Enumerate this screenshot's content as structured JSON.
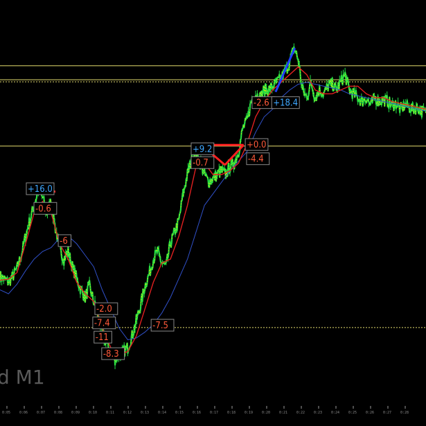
{
  "watermark": "d M1",
  "colors": {
    "background": "#000000",
    "price_green": "#22dd44",
    "price_yellow": "#f2e800",
    "ma_fast": "#e02020",
    "ma_slow": "#3050c8",
    "level_line": "#e8e070",
    "tag_blue": "#3fa8ff",
    "tag_red": "#ff5a3a",
    "tag_box": "#8a8a8a",
    "trade_line_red": "#ff2020",
    "trade_line_blue": "#2040ff"
  },
  "chart_data": {
    "type": "line",
    "title": "",
    "xlabel": "",
    "ylabel": "",
    "grid": false,
    "x_tick_labels": [
      "0:05",
      "0:06",
      "0:07",
      "0:08",
      "0:09",
      "0:10",
      "0:11",
      "0:12",
      "0:13",
      "0:14",
      "0:15",
      "0:16",
      "0:17",
      "0:18",
      "0:19",
      "0:20",
      "0:21",
      "0:22",
      "0:23",
      "0:24",
      "0:25",
      "0:26",
      "0:27",
      "0:28"
    ],
    "ylim": [
      0,
      100
    ],
    "xlim": [
      0,
      100
    ],
    "horizontal_levels": [
      {
        "value": 88.3,
        "style": "solid"
      },
      {
        "value": 84.4,
        "style": "double"
      },
      {
        "value": 67.4,
        "style": "solid"
      },
      {
        "value": 20.2,
        "style": "dotted"
      }
    ],
    "series": [
      {
        "role": "price",
        "x": [
          0,
          1,
          2,
          3,
          4,
          5,
          6,
          7,
          8,
          9,
          10,
          11,
          12,
          13,
          14,
          15,
          16,
          17,
          18,
          19,
          20,
          21,
          22,
          23,
          24,
          25,
          26,
          27,
          28,
          29,
          30,
          31,
          32,
          33,
          34,
          35,
          36,
          37,
          38,
          39,
          40,
          41,
          42,
          43,
          44,
          45,
          46,
          47,
          48,
          49,
          50,
          51,
          52,
          53,
          54,
          55,
          56,
          57,
          58,
          59,
          60,
          61,
          62,
          63,
          64,
          65,
          66,
          67,
          68,
          69,
          70,
          71,
          72,
          73,
          74,
          75,
          76,
          77,
          78,
          79,
          80,
          81,
          82,
          83,
          84,
          85,
          86,
          87,
          88,
          89,
          90,
          91,
          92,
          93,
          94,
          95,
          96,
          97,
          98,
          99,
          100
        ],
        "values": [
          33.5,
          32.8,
          32,
          33.5,
          35.5,
          39,
          44,
          48,
          52,
          56,
          54,
          50,
          53,
          46,
          41,
          38,
          40,
          36,
          33,
          30,
          28,
          31,
          27,
          23,
          19,
          16,
          14,
          12,
          13,
          14,
          15,
          18,
          22,
          26,
          31,
          34,
          38,
          40,
          37,
          36,
          42,
          45,
          48,
          55,
          60,
          64,
          66,
          63,
          60,
          58,
          59,
          60,
          61,
          60,
          62,
          63,
          66,
          72,
          74,
          79,
          81,
          80,
          82,
          82,
          83,
          84,
          85,
          87,
          89,
          93,
          90,
          82,
          80,
          84,
          80,
          82,
          81,
          83,
          83.5,
          82,
          84,
          86,
          82,
          81,
          80,
          79,
          80,
          78,
          80,
          79,
          79.5,
          79,
          78,
          78.5,
          77,
          78,
          77.5,
          77,
          77.5,
          76.5,
          76
        ]
      },
      {
        "role": "moving-average-fast",
        "x": [
          0,
          2,
          4,
          6,
          8,
          10,
          12,
          14,
          16,
          18,
          20,
          22,
          24,
          26,
          28,
          30,
          32,
          34,
          36,
          38,
          40,
          42,
          44,
          46,
          48,
          50,
          52,
          54,
          56,
          58,
          60,
          62,
          64,
          66,
          68,
          70,
          72,
          74,
          76,
          78,
          80,
          82,
          84,
          86,
          88,
          90,
          92,
          94,
          96,
          98,
          100
        ],
        "values": [
          32.5,
          32.8,
          34.5,
          42,
          50,
          53,
          50,
          42,
          38,
          32,
          29,
          27,
          20,
          15,
          13,
          14,
          18,
          25,
          32,
          37,
          38,
          44,
          52,
          62,
          63,
          60,
          60,
          61,
          63,
          68,
          75,
          79,
          82,
          84,
          86,
          88,
          86,
          82,
          81,
          81,
          82,
          83,
          83,
          81,
          80,
          80,
          79,
          78.5,
          78,
          77.5,
          77
        ]
      },
      {
        "role": "moving-average-slow",
        "x": [
          0,
          2,
          4,
          6,
          8,
          10,
          12,
          14,
          16,
          18,
          20,
          22,
          24,
          26,
          28,
          30,
          32,
          34,
          36,
          38,
          40,
          42,
          44,
          46,
          48,
          50,
          52,
          54,
          56,
          58,
          60,
          62,
          64,
          66,
          68,
          70,
          72,
          74,
          76,
          78,
          80,
          82,
          84,
          86,
          88,
          90,
          92,
          94,
          96,
          98,
          100
        ],
        "values": [
          30,
          29,
          31.5,
          35,
          38,
          40,
          41,
          43.5,
          44,
          42,
          39,
          36,
          30,
          25,
          20,
          17,
          17.5,
          19,
          21,
          24,
          28,
          33,
          38,
          45,
          52,
          55,
          58,
          61,
          63.5,
          66,
          71,
          75,
          77,
          80,
          82,
          83.5,
          84,
          83.5,
          83,
          82.5,
          82,
          81,
          80.5,
          80,
          79.5,
          79,
          78.5,
          78,
          77.5,
          77,
          76.5
        ]
      }
    ],
    "annotations": [
      {
        "text": "+16.0",
        "color": "blue",
        "x": 6.5,
        "y": 55.5
      },
      {
        "text": "-0.6",
        "color": "red",
        "x": 8.3,
        "y": 50.4
      },
      {
        "text": "-6",
        "color": "red",
        "x": 14,
        "y": 42
      },
      {
        "text": "-2.0",
        "color": "red",
        "x": 22.6,
        "y": 24.3
      },
      {
        "text": "-7.4",
        "color": "red",
        "x": 22.1,
        "y": 20.6
      },
      {
        "text": "-11",
        "color": "red",
        "x": 22.4,
        "y": 16.9
      },
      {
        "text": "-8.3",
        "color": "red",
        "x": 24.2,
        "y": 12.6
      },
      {
        "text": "-7.5",
        "color": "red",
        "x": 35.8,
        "y": 20
      },
      {
        "text": "+9.2",
        "color": "blue",
        "x": 45.2,
        "y": 65.9
      },
      {
        "text": "-0.7",
        "color": "red",
        "x": 45.2,
        "y": 62.3
      },
      {
        "text": "+0.0",
        "color": "red",
        "x": 57.9,
        "y": 67
      },
      {
        "text": "-4.4",
        "color": "red",
        "x": 58.2,
        "y": 63.3
      },
      {
        "text": "-2.6",
        "color": "red",
        "x": 59.5,
        "y": 77.9
      },
      {
        "text": "+18.4",
        "color": "blue",
        "x": 64.1,
        "y": 77.9
      }
    ],
    "trade_segments": [
      {
        "color": "red",
        "from": [
          9,
          55
        ],
        "to": [
          13,
          55.6
        ]
      },
      {
        "color": "red",
        "from": [
          47.3,
          67.7
        ],
        "to": [
          52.8,
          62.5
        ]
      },
      {
        "color": "red",
        "from": [
          52.8,
          62.5
        ],
        "to": [
          57.2,
          67.7
        ]
      },
      {
        "color": "red",
        "from": [
          47.3,
          67.7
        ],
        "to": [
          57.2,
          67.7
        ]
      },
      {
        "color": "blue",
        "from": [
          64.7,
          81.5
        ],
        "to": [
          69.2,
          92.9
        ]
      }
    ]
  }
}
